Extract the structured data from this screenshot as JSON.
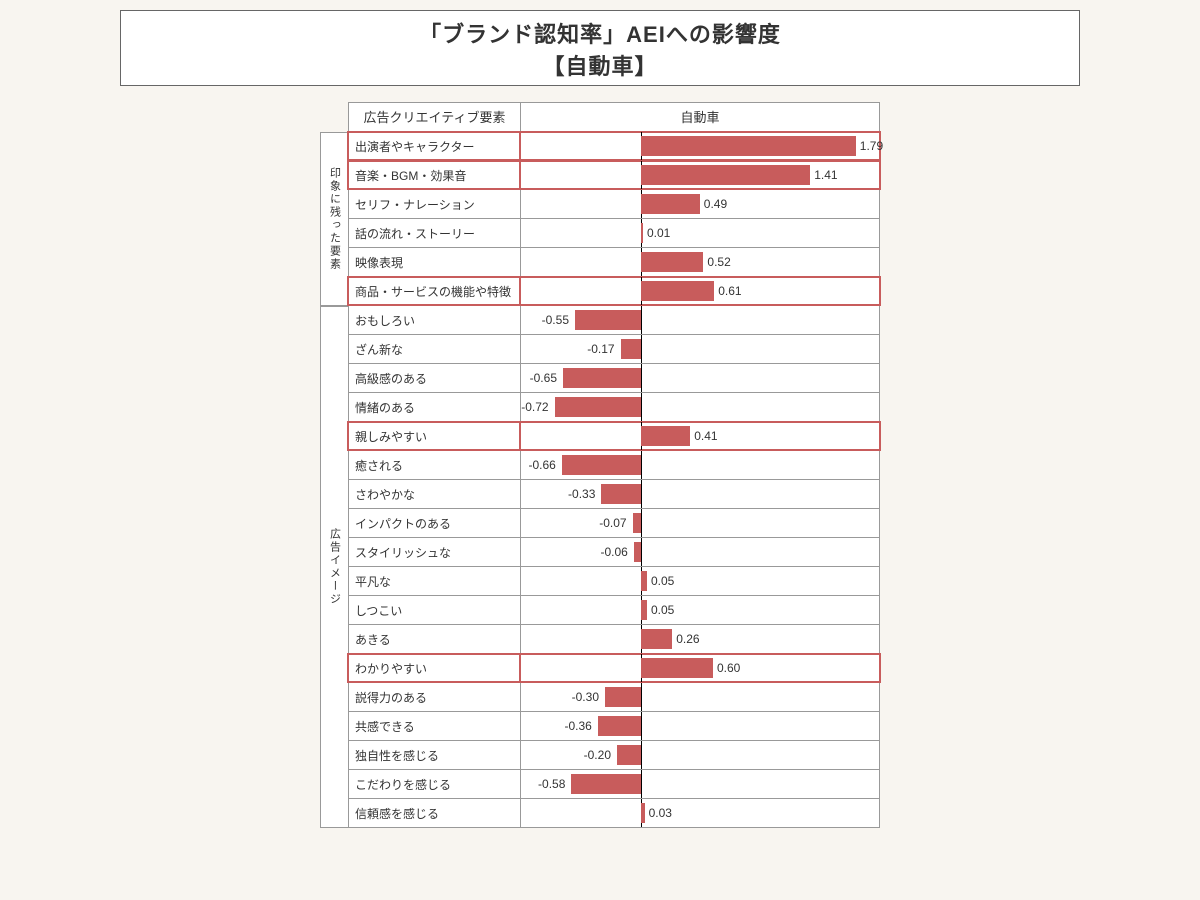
{
  "title_line1": "「ブランド認知率」AEIへの影響度",
  "title_line2": "【自動車】",
  "header_left": "広告クリエイティブ要素",
  "header_right": "自動車",
  "group1_label": "印象に残った要素",
  "group2_label": "広告イメージ",
  "chart_data": {
    "type": "bar",
    "orientation": "horizontal",
    "title": "「ブランド認知率」AEIへの影響度 【自動車】",
    "ylabel": "広告クリエイティブ要素",
    "xlabel": "自動車",
    "xlim": [
      -1.0,
      2.0
    ],
    "zero_at": 0,
    "series": [
      {
        "name": "自動車",
        "color": "#C85C5C",
        "items": [
          {
            "group": "印象に残った要素",
            "label": "出演者やキャラクター",
            "value": 1.79,
            "highlight": true
          },
          {
            "group": "印象に残った要素",
            "label": "音楽・BGM・効果音",
            "value": 1.41,
            "highlight": true
          },
          {
            "group": "印象に残った要素",
            "label": "セリフ・ナレーション",
            "value": 0.49,
            "highlight": false
          },
          {
            "group": "印象に残った要素",
            "label": "話の流れ・ストーリー",
            "value": 0.01,
            "highlight": false
          },
          {
            "group": "印象に残った要素",
            "label": "映像表現",
            "value": 0.52,
            "highlight": false
          },
          {
            "group": "印象に残った要素",
            "label": "商品・サービスの機能や特徴",
            "value": 0.61,
            "highlight": true
          },
          {
            "group": "広告イメージ",
            "label": "おもしろい",
            "value": -0.55,
            "highlight": false
          },
          {
            "group": "広告イメージ",
            "label": "ざん新な",
            "value": -0.17,
            "highlight": false
          },
          {
            "group": "広告イメージ",
            "label": "高級感のある",
            "value": -0.65,
            "highlight": false
          },
          {
            "group": "広告イメージ",
            "label": "情緒のある",
            "value": -0.72,
            "highlight": false
          },
          {
            "group": "広告イメージ",
            "label": "親しみやすい",
            "value": 0.41,
            "highlight": true
          },
          {
            "group": "広告イメージ",
            "label": "癒される",
            "value": -0.66,
            "highlight": false
          },
          {
            "group": "広告イメージ",
            "label": "さわやかな",
            "value": -0.33,
            "highlight": false
          },
          {
            "group": "広告イメージ",
            "label": "インパクトのある",
            "value": -0.07,
            "highlight": false
          },
          {
            "group": "広告イメージ",
            "label": "スタイリッシュな",
            "value": -0.06,
            "highlight": false
          },
          {
            "group": "広告イメージ",
            "label": "平凡な",
            "value": 0.05,
            "highlight": false
          },
          {
            "group": "広告イメージ",
            "label": "しつこい",
            "value": 0.05,
            "highlight": false
          },
          {
            "group": "広告イメージ",
            "label": "あきる",
            "value": 0.26,
            "highlight": false
          },
          {
            "group": "広告イメージ",
            "label": "わかりやすい",
            "value": 0.6,
            "highlight": true
          },
          {
            "group": "広告イメージ",
            "label": "説得力のある",
            "value": -0.3,
            "highlight": false
          },
          {
            "group": "広告イメージ",
            "label": "共感できる",
            "value": -0.36,
            "highlight": false
          },
          {
            "group": "広告イメージ",
            "label": "独自性を感じる",
            "value": -0.2,
            "highlight": false
          },
          {
            "group": "広告イメージ",
            "label": "こだわりを感じる",
            "value": -0.58,
            "highlight": false
          },
          {
            "group": "広告イメージ",
            "label": "信頼感を感じる",
            "value": 0.03,
            "highlight": false
          }
        ]
      }
    ]
  }
}
